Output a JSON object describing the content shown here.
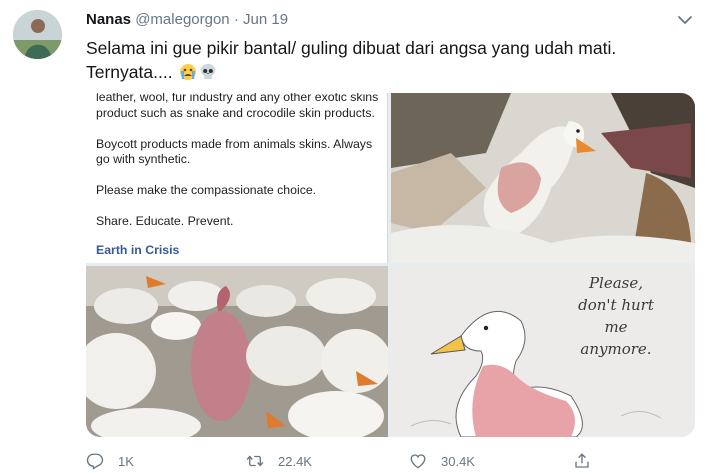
{
  "tweet": {
    "author_name": "Nanas",
    "author_handle": "@malegorgon",
    "separator": "·",
    "date": "Jun 19",
    "text": "Selama ini gue pikir bantal/ guling dibuat dari angsa yang udah mati. Ternyata.... ",
    "emojis": [
      "crying-face-emoji",
      "skull-emoji"
    ]
  },
  "media": {
    "post": {
      "line1": "leather, wool, fur industry and any other exotic skins product such as snake and crocodile skin products.",
      "line2": "Boycott products made from animals skins. Always go with synthetic.",
      "line3": "Please make the compassionate choice.",
      "line4": "Share. Educate. Prevent.",
      "link": "Earth in Crisis"
    },
    "illustration_text": [
      "Please,",
      "don't hurt",
      "me",
      "anymore."
    ]
  },
  "actions": {
    "reply_count": "1K",
    "retweet_count": "22.4K",
    "like_count": "30.4K"
  },
  "colors": {
    "text": "#14171a",
    "muted": "#657786",
    "link": "#385898"
  }
}
